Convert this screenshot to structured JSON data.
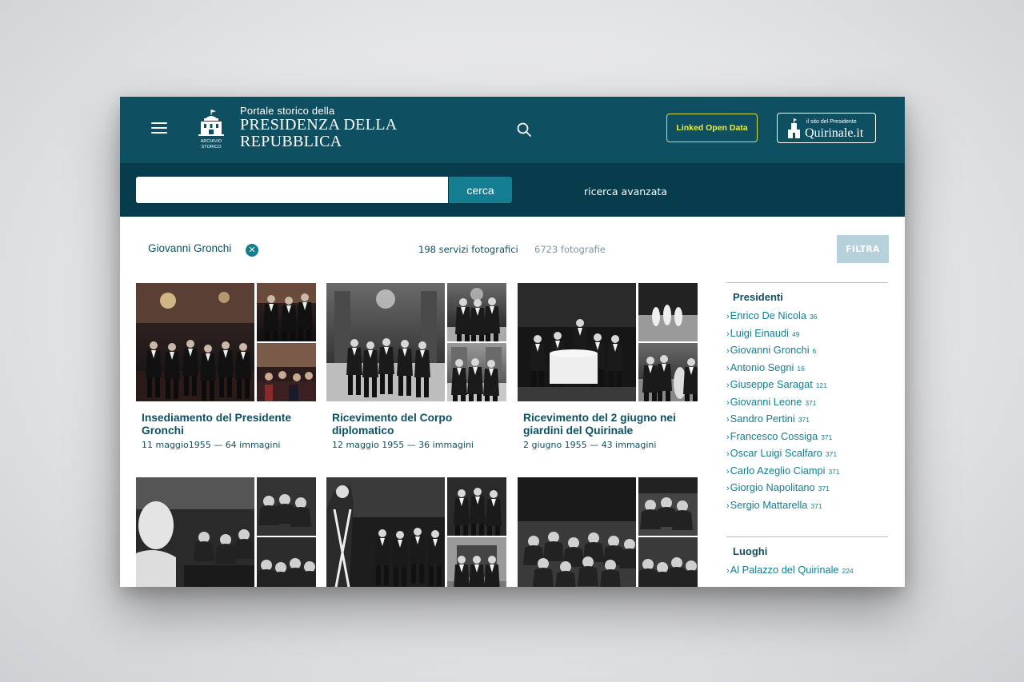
{
  "header": {
    "subtitle": "Portale storico della",
    "title": "PRESIDENZA DELLA REPUBBLICA",
    "logo_text_1": "ARCHIVIO",
    "logo_text_2": "STORICO",
    "linked_open_data": "Linked Open Data",
    "quirinale_small": "il sito del Presidente",
    "quirinale_big": "Quirinale.it"
  },
  "search": {
    "placeholder": "",
    "button": "cerca",
    "advanced": "ricerca avanzata"
  },
  "filters": {
    "active": "Giovanni Gronchi",
    "services_count": "198 servizi fotografici",
    "photos_count": "6723 fotografie",
    "filter_button": "FILTRA"
  },
  "cards": [
    {
      "title": "Insediamento del Presidente Gronchi",
      "meta": "11 maggio1955 — 64 immagini"
    },
    {
      "title": "Ricevimento del Corpo diplomatico",
      "meta": "12 maggio 1955 — 36 immagini"
    },
    {
      "title": "Ricevimento del 2 giugno nei giardini del Quirinale",
      "meta": "2 giugno 1955 — 43 immagini"
    },
    {
      "title": "",
      "meta": ""
    },
    {
      "title": "",
      "meta": ""
    },
    {
      "title": "",
      "meta": ""
    }
  ],
  "sidebar": {
    "presidents_title": "Presidenti",
    "presidents": [
      {
        "name": "Enrico De Nicola",
        "count": "36"
      },
      {
        "name": "Luigi Einaudi",
        "count": "49"
      },
      {
        "name": "Giovanni Gronchi",
        "count": "6"
      },
      {
        "name": "Antonio Segni",
        "count": "16"
      },
      {
        "name": "Giuseppe Saragat",
        "count": "121"
      },
      {
        "name": "Giovanni Leone",
        "count": "371"
      },
      {
        "name": "Sandro Pertini",
        "count": "371"
      },
      {
        "name": "Francesco Cossiga",
        "count": "371"
      },
      {
        "name": "Oscar Luigi Scalfaro",
        "count": "371"
      },
      {
        "name": "Carlo Azeglio Ciampi",
        "count": "371"
      },
      {
        "name": "Giorgio Napolitano",
        "count": "371"
      },
      {
        "name": "Sergio Mattarella",
        "count": "371"
      }
    ],
    "places_title": "Luoghi",
    "places": [
      {
        "name": "Al Palazzo del Quirinale",
        "count": "224"
      }
    ]
  },
  "colors": {
    "header": "#0f4f62",
    "searchbar": "#063c4c",
    "accent": "#137d92",
    "lod": "#e7ef45"
  }
}
